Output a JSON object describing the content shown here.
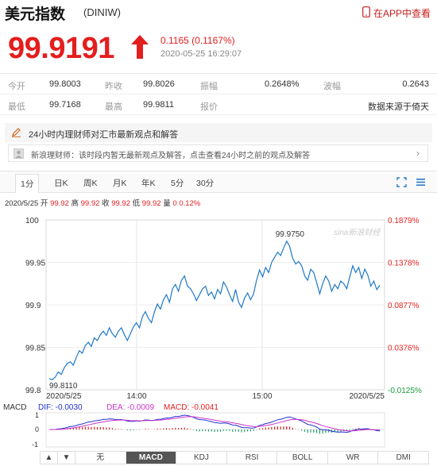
{
  "header": {
    "title": "美元指数",
    "symbol": "(DINIW)",
    "app_link": "在APP中查看"
  },
  "quote": {
    "price": "99.9191",
    "change": "0.1165 (0.1167%)",
    "timestamp": "2020-05-25 16:29:07",
    "direction": "up",
    "up_color": "#e41e1e"
  },
  "stats": {
    "row1": [
      {
        "label": "今开",
        "value": "99.8003"
      },
      {
        "label": "昨收",
        "value": "99.8026"
      },
      {
        "label": "振幅",
        "value": "0.2648%"
      },
      {
        "label": "波幅",
        "value": "0.2643"
      }
    ],
    "row2": [
      {
        "label": "最低",
        "value": "99.7168"
      },
      {
        "label": "最高",
        "value": "99.9811"
      },
      {
        "label": "报价",
        "value": "数据来源于倚天"
      }
    ]
  },
  "advisor": {
    "headline": "24小时内理财师对汇市最新观点和解答",
    "notice": "新浪理财师：该时段内暂无最新观点及解答，点击查看24小时之前的观点及解答"
  },
  "tabs": {
    "items": [
      "1分",
      "日K",
      "周K",
      "月K",
      "年K",
      "5分",
      "30分"
    ],
    "active": "1分"
  },
  "quote_row": {
    "date": "2020/5/25",
    "open_label": "开",
    "open": "99.92",
    "high_label": "高",
    "high": "99.92",
    "close_label": "收",
    "close": "99.92",
    "low_label": "低",
    "low": "99.92",
    "vol_label": "量",
    "vol": "0",
    "pct": "0.12%"
  },
  "chart_data": {
    "type": "line",
    "watermark": "sina新浪财经",
    "y_ticks": [
      "100",
      "99.95",
      "99.9",
      "99.85",
      "99.8"
    ],
    "y_values": [
      100,
      99.95,
      99.9,
      99.85,
      99.8
    ],
    "pct_ticks": [
      "0.1879%",
      "0.1378%",
      "0.0877%",
      "0.0376%",
      "-0.0125%"
    ],
    "ylim": [
      99.8,
      100
    ],
    "x_ticks": [
      "2020/5/25",
      "14:00",
      "15:00",
      "2020/5/25"
    ],
    "max_label": "99.9750",
    "min_label": "99.8110",
    "line_color": "#1e78c8",
    "values": [
      99.813,
      99.812,
      99.815,
      99.821,
      99.818,
      99.826,
      99.831,
      99.833,
      99.829,
      99.838,
      99.846,
      99.843,
      99.852,
      99.856,
      99.851,
      99.861,
      99.858,
      99.865,
      99.869,
      99.864,
      99.873,
      99.866,
      99.862,
      99.869,
      99.873,
      99.865,
      99.858,
      99.866,
      99.874,
      99.879,
      99.873,
      99.886,
      99.892,
      99.884,
      99.879,
      99.892,
      99.901,
      99.895,
      99.906,
      99.912,
      99.903,
      99.919,
      99.924,
      99.916,
      99.929,
      99.934,
      99.922,
      99.919,
      99.913,
      99.905,
      99.912,
      99.919,
      99.922,
      99.911,
      99.915,
      99.907,
      99.918,
      99.913,
      99.927,
      99.921,
      99.912,
      99.904,
      99.918,
      99.903,
      99.897,
      99.908,
      99.914,
      99.906,
      99.913,
      99.929,
      99.941,
      99.933,
      99.944,
      99.938,
      99.95,
      99.956,
      99.962,
      99.958,
      99.967,
      99.975,
      99.969,
      99.955,
      99.948,
      99.951,
      99.946,
      99.934,
      99.929,
      99.942,
      99.938,
      99.926,
      99.913,
      99.925,
      99.934,
      99.928,
      99.916,
      99.924,
      99.919,
      99.928,
      99.925,
      99.919,
      99.933,
      99.946,
      99.938,
      99.944,
      99.931,
      99.942,
      99.935,
      99.922,
      99.928,
      99.918,
      99.923
    ],
    "macd": {
      "label": "MACD",
      "dif_label": "DIF: -0.0030",
      "dea_label": "DEA: -0.0009",
      "macd_label": "MACD: -0.0041",
      "y_ticks": [
        "1",
        "0",
        "-1"
      ],
      "dif_color": "#2233cc",
      "dea_color": "#cc33cc",
      "pos_color": "#cc2222",
      "neg_color": "#2a9a6a"
    }
  },
  "bottom_tabs": {
    "nav_up": "▲",
    "nav_down": "▼",
    "items": [
      "无",
      "MACD",
      "KDJ",
      "RSI",
      "BOLL",
      "WR",
      "DMI"
    ],
    "active": "MACD"
  }
}
